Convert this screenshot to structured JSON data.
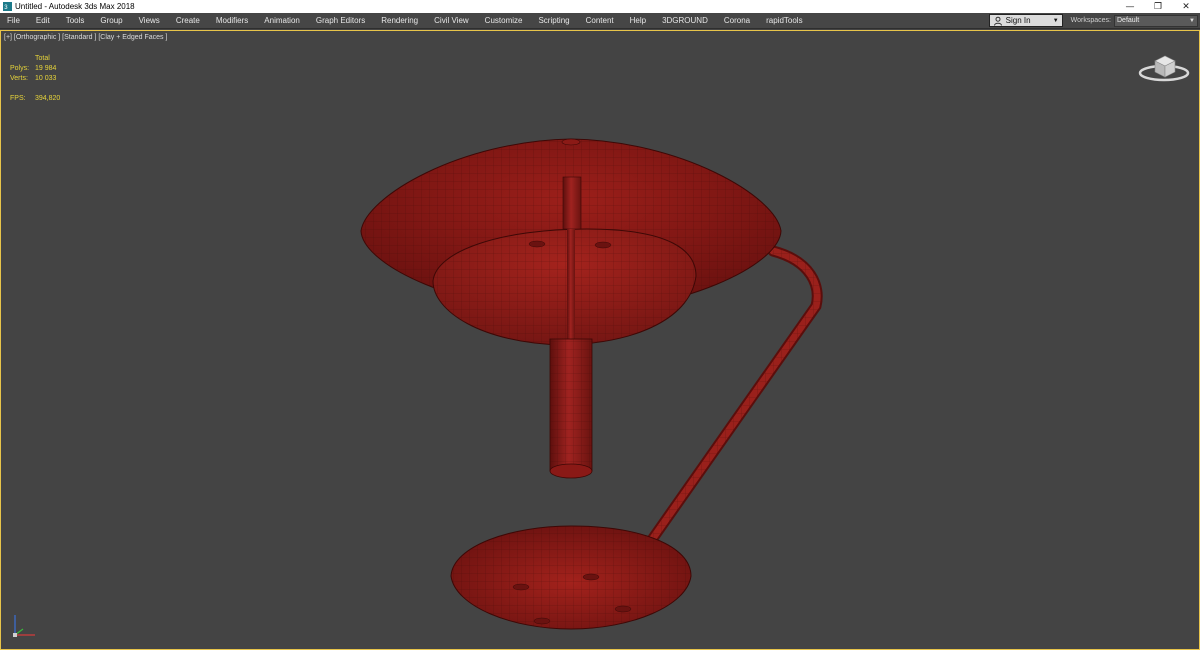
{
  "window": {
    "title": "Untitled - Autodesk 3ds Max 2018",
    "controls": {
      "minimize": "—",
      "restore": "❐",
      "close": "✕"
    }
  },
  "menu": [
    "File",
    "Edit",
    "Tools",
    "Group",
    "Views",
    "Create",
    "Modifiers",
    "Animation",
    "Graph Editors",
    "Rendering",
    "Civil View",
    "Customize",
    "Scripting",
    "Content",
    "Help",
    "3DGROUND",
    "Corona",
    "rapidTools"
  ],
  "account": {
    "signin_label": "Sign In"
  },
  "workspaces": {
    "label": "Workspaces:",
    "value": "Default"
  },
  "viewport": {
    "label": "[+] [Orthographic ] [Standard ] [Clay + Edged Faces ]",
    "stats": {
      "header": "Total",
      "polys_label": "Polys:",
      "polys_value": "19 984",
      "verts_label": "Verts:",
      "verts_value": "10 033",
      "fps_label": "FPS:",
      "fps_value": "394,820"
    }
  },
  "colors": {
    "stats_yellow": "#e6d43a",
    "viewport_border": "#e8c44a",
    "model_red": "#8f1a16",
    "viewport_bg": "#444444"
  },
  "icons": {
    "app": "3ds-max-icon",
    "user": "user-icon",
    "viewcube": "viewcube-icon",
    "axis": "axis-tripod-icon"
  }
}
